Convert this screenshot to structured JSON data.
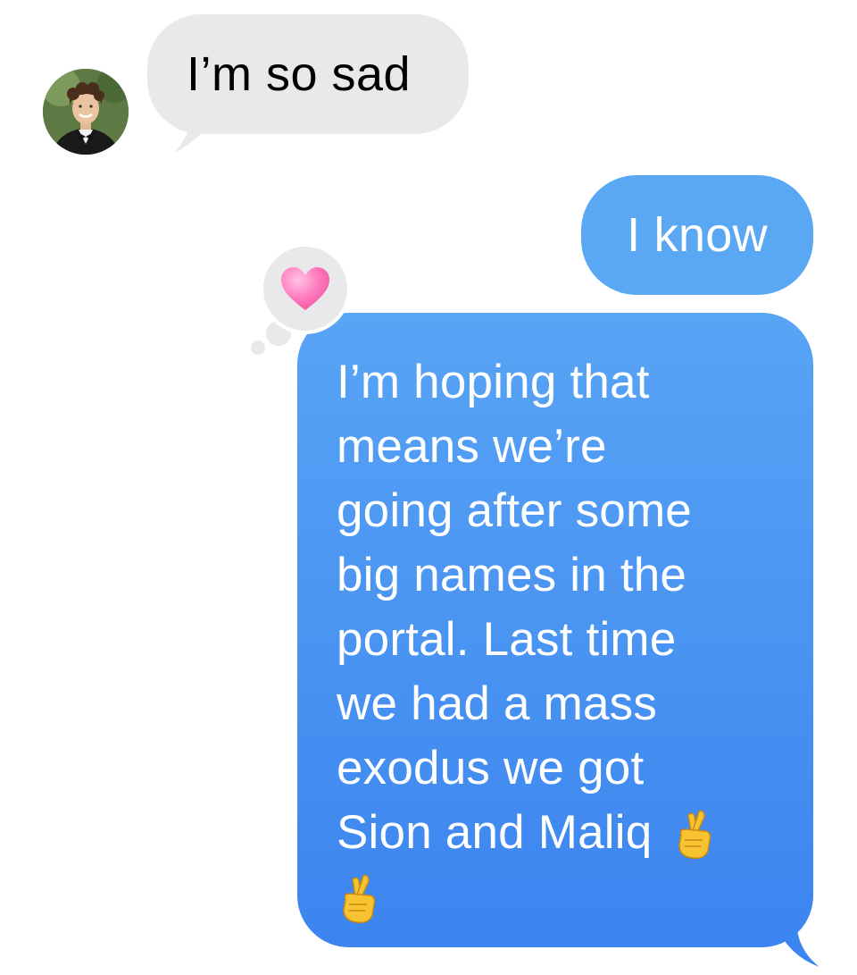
{
  "thread": {
    "received": [
      {
        "text": "I’m so sad"
      }
    ],
    "sent": [
      {
        "text": "I know"
      },
      {
        "lines": [
          "I’m hoping that",
          "means we’re",
          "going after some",
          "big names in the",
          "portal. Last time",
          "we had a mass",
          "exodus we got",
          "Sion and Maliq "
        ],
        "emoji": "crossed-fingers-icon"
      }
    ],
    "tapback": {
      "icon": "heart-icon",
      "color": "#ff6fb5"
    }
  },
  "colors": {
    "received_bubble": "#e9e9eb",
    "sent_bubble_top": "#58a4f5",
    "sent_bubble_bottom": "#3c84ef",
    "background": "#ffffff"
  }
}
